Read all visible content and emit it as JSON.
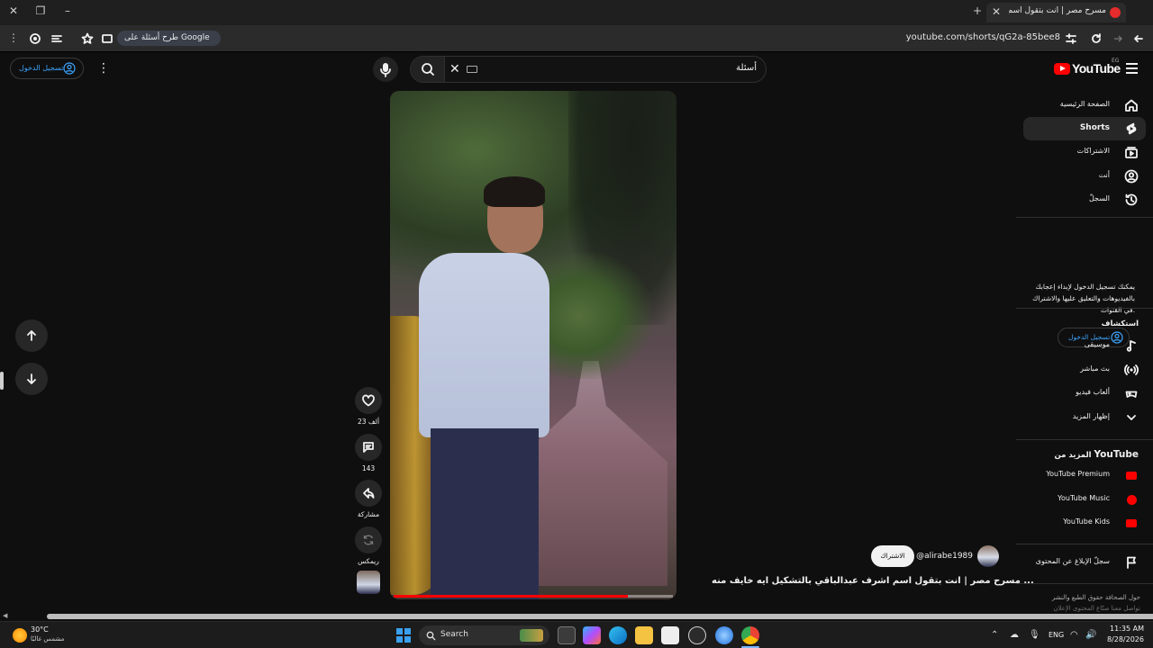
{
  "browser": {
    "tab_title": "مسرح مصر | انت بتقول اسم اشرف",
    "url": "youtube.com/shorts/qG2a-85bee8",
    "google_chip": "طرح أسئلة على Google"
  },
  "header": {
    "signin_label": "تسجيل الدخول",
    "search_query": "أسئلة",
    "logo_text": "YouTube",
    "country_code": "EG"
  },
  "sidebar": {
    "items": [
      {
        "label": "الصفحة الرئيسية",
        "icon": "home-icon"
      },
      {
        "label": "Shorts",
        "icon": "shorts-icon"
      },
      {
        "label": "الاشتراكات",
        "icon": "subscriptions-icon"
      },
      {
        "label": "أنت",
        "icon": "you-icon"
      },
      {
        "label": "السجلّ",
        "icon": "history-icon"
      }
    ],
    "signin_prompt": "يمكنك تسجيل الدخول لإبداء إعجابك بالفيديوهات والتعليق عليها والاشتراك في القنوات.",
    "signin_button": "تسجيل الدخول",
    "explore_heading": "استكشاف",
    "explore": [
      {
        "label": "موسيقى",
        "icon": "music-icon"
      },
      {
        "label": "بث مباشر",
        "icon": "live-icon"
      },
      {
        "label": "ألعاب فيديو",
        "icon": "gaming-icon"
      },
      {
        "label": "إظهار المزيد",
        "icon": "chevron-down-icon"
      }
    ],
    "more_heading_prefix": "المزيد من",
    "more_heading_brand": "YouTube",
    "more": [
      {
        "label": "YouTube Premium"
      },
      {
        "label": "YouTube Music"
      },
      {
        "label": "YouTube Kids"
      }
    ],
    "report_history": "سجلّ الإبلاغ عن المحتوى",
    "footer_line1": "حول  الصحافة  حقوق الطبع والنشر",
    "footer_line2": "تواصل معنا  صنّاع المحتوى  الإعلان"
  },
  "short": {
    "likes": "23 ألف",
    "comments": "143",
    "share": "مشاركة",
    "remix": "ريمكس",
    "channel": "@alirabe1989",
    "subscribe": "الاشتراك",
    "title": "مسرح مصر | انت بتقول اسم اشرف عبدالباقي بالتشكيل ايه خايف منه ...",
    "progress": 0.84
  },
  "taskbar": {
    "temperature": "30°C",
    "weather": "مشمس غالبًا",
    "search_label": "Search",
    "language": "ENG",
    "time": "11:35 AM",
    "date": "8/28/2026"
  },
  "colors": {
    "accent_red": "#ff0000",
    "link_blue": "#3ea6ff",
    "background": "#0f0f0f"
  }
}
